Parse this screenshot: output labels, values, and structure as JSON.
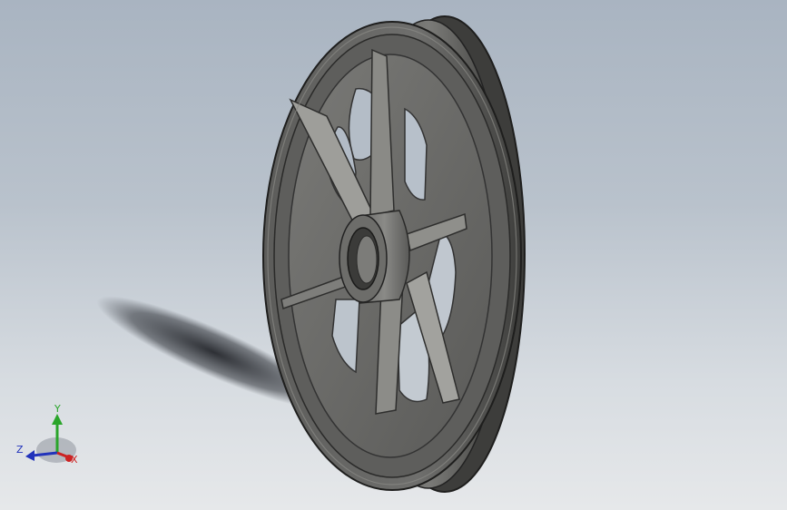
{
  "viewport": {
    "background_top": "#a9b4c1",
    "background_bottom": "#e6e8ea"
  },
  "model": {
    "part": "pulley-wheel",
    "spoke_count": 6,
    "body_color": "#6f6f6d",
    "dark_color": "#3e3e3c",
    "light_color": "#9a9a97"
  },
  "triad": {
    "y_label": "Y",
    "z_label": "Z",
    "x_label": "X",
    "y_color": "#2aa52a",
    "z_color": "#2233bb",
    "x_color": "#cc2222"
  }
}
